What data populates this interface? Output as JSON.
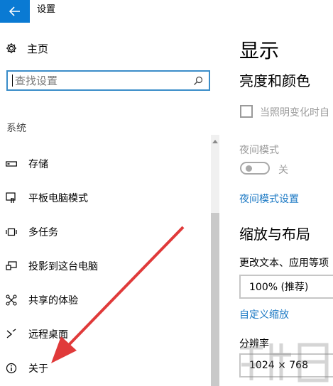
{
  "window": {
    "title": "设置"
  },
  "sidebar": {
    "home_label": "主页",
    "search_placeholder": "查找设置",
    "section_label": "系统",
    "items": [
      {
        "label": "存储",
        "icon": "storage-icon"
      },
      {
        "label": "平板电脑模式",
        "icon": "tablet-mode-icon"
      },
      {
        "label": "多任务",
        "icon": "multitasking-icon"
      },
      {
        "label": "投影到这台电脑",
        "icon": "project-icon"
      },
      {
        "label": "共享的体验",
        "icon": "shared-experiences-icon"
      },
      {
        "label": "远程桌面",
        "icon": "remote-desktop-icon"
      },
      {
        "label": "关于",
        "icon": "info-icon"
      }
    ]
  },
  "main": {
    "heading": "显示",
    "brightness_heading": "亮度和颜色",
    "auto_brightness_label": "当照明变化时自",
    "night_mode_label": "夜间模式",
    "night_mode_state": "关",
    "night_mode_settings_link": "夜间模式设置",
    "scale_heading": "缩放与布局",
    "scale_label": "更改文本、应用等项",
    "scale_value": "100% (推荐)",
    "custom_scale_link": "自定义缩放",
    "resolution_label": "分辨率",
    "resolution_value": "1024 × 768"
  },
  "colors": {
    "accent": "#0a7ad3",
    "link": "#1c79c4",
    "annotation_arrow": "#e03a3a"
  }
}
